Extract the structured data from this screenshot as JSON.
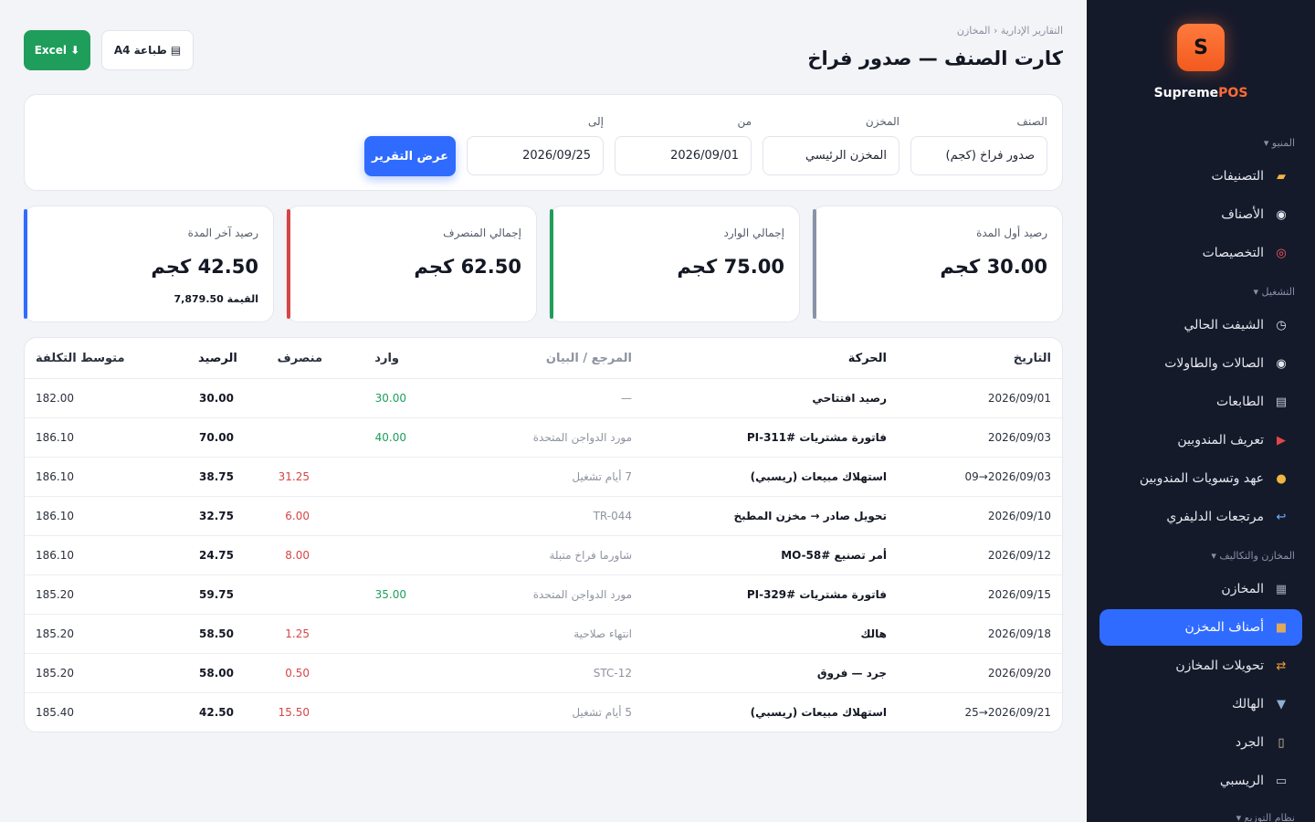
{
  "sidebar": {
    "logo_letter": "S",
    "brand_main": "Supreme",
    "brand_accent": "POS",
    "sections": [
      {
        "title": "المنيو ▾"
      },
      {
        "title": "التشغيل ▾"
      },
      {
        "title": "المخازن والتكاليف ▾"
      },
      {
        "title": "نظام التوزيع ▾"
      }
    ],
    "items": [
      {
        "label": "التصنيفات",
        "icon": "folder-icon"
      },
      {
        "label": "الأصناف",
        "icon": "plate-icon"
      },
      {
        "label": "التخصيصات",
        "icon": "target-icon"
      },
      {
        "label": "الشيفت الحالي",
        "icon": "stopwatch-icon"
      },
      {
        "label": "الصالات والطاولات",
        "icon": "plate-icon"
      },
      {
        "label": "الطابعات",
        "icon": "printer-icon"
      },
      {
        "label": "تعريف المندوبين",
        "icon": "motorcycle-icon"
      },
      {
        "label": "عهد وتسويات المندوبين",
        "icon": "money-bag-icon"
      },
      {
        "label": "مرتجعات الدليفري",
        "icon": "return-icon"
      },
      {
        "label": "المخازن",
        "icon": "warehouse-icon"
      },
      {
        "label": "أصناف المخزن",
        "icon": "box-icon"
      },
      {
        "label": "تحويلات المخازن",
        "icon": "repeat-icon"
      },
      {
        "label": "الهالك",
        "icon": "trash-icon"
      },
      {
        "label": "الجرد",
        "icon": "clipboard-icon"
      },
      {
        "label": "الريسبي",
        "icon": "receipt-icon"
      }
    ]
  },
  "header": {
    "breadcrumb": "التقارير الإدارية ‹ المخازن",
    "title": "كارت الصنف — صدور فراخ",
    "excel_label": "Excel ⬇",
    "print_label": "طباعة A4"
  },
  "filters": {
    "item_label": "الصنف",
    "item_value": "صدور فراخ (كجم)",
    "store_label": "المخزن",
    "store_value": "المخزن الرئيسي",
    "from_label": "من",
    "from_value": "2026/09/01",
    "to_label": "إلى",
    "to_value": "2026/09/25",
    "show_button": "عرض التقرير"
  },
  "kpis": [
    {
      "label": "رصيد أول المدة",
      "value": "30.00 كجم",
      "color": "#8a93a6"
    },
    {
      "label": "إجمالي الوارد",
      "value": "75.00 كجم",
      "color": "#1e9e5a"
    },
    {
      "label": "إجمالي المنصرف",
      "value": "62.50 كجم",
      "color": "#d64545"
    },
    {
      "label": "رصيد آخر المدة",
      "value": "42.50 كجم",
      "sub": "القيمة 7,879.50",
      "color": "#2f6bff"
    }
  ],
  "table": {
    "headers": {
      "date": "التاريخ",
      "movement": "الحركة",
      "reference": "المرجع / البيان",
      "in": "وارد",
      "out": "منصرف",
      "balance": "الرصيد",
      "avg_cost": "متوسط التكلفة"
    },
    "rows": [
      {
        "date": "2026/09/01",
        "movement": "رصيد افتتاحي",
        "reference": "—",
        "in": "30.00",
        "out": "",
        "balance": "30.00",
        "avg_cost": "182.00"
      },
      {
        "date": "2026/09/03",
        "movement": "فاتورة مشتريات PI-311#",
        "reference": "مورد الدواجن المتحدة",
        "in": "40.00",
        "out": "",
        "balance": "70.00",
        "avg_cost": "186.10"
      },
      {
        "date": "2026/09/03→09",
        "movement": "استهلاك مبيعات (ريسبي)",
        "reference": "7 أيام تشغيل",
        "in": "",
        "out": "31.25",
        "balance": "38.75",
        "avg_cost": "186.10"
      },
      {
        "date": "2026/09/10",
        "movement": "تحويل صادر → مخزن المطبخ",
        "reference": "TR-044",
        "in": "",
        "out": "6.00",
        "balance": "32.75",
        "avg_cost": "186.10"
      },
      {
        "date": "2026/09/12",
        "movement": "أمر تصنيع MO-58#",
        "reference": "شاورما فراخ متبلة",
        "in": "",
        "out": "8.00",
        "balance": "24.75",
        "avg_cost": "186.10"
      },
      {
        "date": "2026/09/15",
        "movement": "فاتورة مشتريات PI-329#",
        "reference": "مورد الدواجن المتحدة",
        "in": "35.00",
        "out": "",
        "balance": "59.75",
        "avg_cost": "185.20"
      },
      {
        "date": "2026/09/18",
        "movement": "هالك",
        "reference": "انتهاء صلاحية",
        "in": "",
        "out": "1.25",
        "balance": "58.50",
        "avg_cost": "185.20"
      },
      {
        "date": "2026/09/20",
        "movement": "جرد — فروق",
        "reference": "STC-12",
        "in": "",
        "out": "0.50",
        "balance": "58.00",
        "avg_cost": "185.20"
      },
      {
        "date": "2026/09/21→25",
        "movement": "استهلاك مبيعات (ريسبي)",
        "reference": "5 أيام تشغيل",
        "in": "",
        "out": "15.50",
        "balance": "42.50",
        "avg_cost": "185.40"
      }
    ]
  }
}
